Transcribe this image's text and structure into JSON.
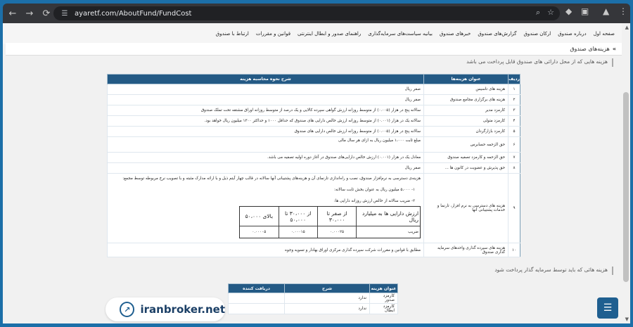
{
  "browser": {
    "url": "ayaretf.com/AboutFund/FundCost",
    "back_icon": "←",
    "forward_icon": "→",
    "reload_icon": "⟳",
    "site_info_icon": "☰",
    "zoom_icon": "⌕",
    "star_icon": "☆",
    "ext1_icon": "◆",
    "ext2_icon": "▣",
    "profile_icon": "▲",
    "menu_icon": "⋮"
  },
  "nav": {
    "items": [
      "صفحه اول",
      "درباره صندوق",
      "ارکان صندوق",
      "گزارش‌های صندوق",
      "خبرهای صندوق",
      "بیانیه سیاست‌های سرمایه‌گذاری",
      "راهنمای صدور و ابطال اینترنتی",
      "قوانین و مقررات",
      "ارتباط با صندوق"
    ]
  },
  "breadcrumb": {
    "arrow": "»",
    "label": "هزینه‌های صندوق"
  },
  "notes": {
    "fund_costs": "هزینه هایی که از محل دارائی های صندوق قابل پرداخت می باشد",
    "investor_costs": "هزینه هائی که باید توسط سرمایه گذار پرداخت شود"
  },
  "main_table": {
    "headers": {
      "row": "ردیف",
      "title": "عنوان هزینه‌ها",
      "desc": "شرح نحوه محاسبه هزینه"
    },
    "rows": [
      {
        "num": "۱",
        "title": "هزینه های تاسیس",
        "desc": "صفر ریال"
      },
      {
        "num": "۲",
        "title": "هزینه های برگزاری مجامع صندوق",
        "desc": "صفر ریال"
      },
      {
        "num": "۳",
        "title": "کارمزد مدیر",
        "desc": "سالانه پنج در هزار (۰.۰۰۵) از متوسط روزانه ارزش گواهی سپرده کالایی و یک درصد از متوسط روزانه اوراق مشتقه تحت تملک صندوق"
      },
      {
        "num": "۴",
        "title": "کارمزد متولی",
        "desc": "سالانه یک در هزار (۰.۰۰۱) از متوسط روزانه ارزش خالص دارایی های صندوق که حداقل ۱۰۰۰ و حداکثر ۱۳۰۰ میلیون ریال خواهد بود."
      },
      {
        "num": "۵",
        "title": "کارمزد بازارگردان",
        "desc": "سالانه پنج در هزار (۰.۰۰۵) از متوسط روزانه ارزش خالص دارایی های صندوق"
      },
      {
        "num": "۶",
        "title": "حق الزحمه حسابرس",
        "desc": "مبلغ ثابت ۱،۰۰۰ میلیون ریال به ازای هر سال مالی"
      },
      {
        "num": "۷",
        "title": "حق الزحمه و کارمزد تصفیه صندوق",
        "desc": "معادل یک در هزار (۰.۰۰۱) ارزش خالص دارایی‌های صندوق در آغاز دوره اولیه تصفیه می باشد."
      },
      {
        "num": "۸",
        "title": "حق پذیرش و عضویت در کانون ها ...",
        "desc": "صفر ریال"
      }
    ],
    "row9": {
      "num": "۹",
      "title": "هزینه های دسترسی به نرم افزار، تارنما و خدمات پشتیبانی آنها",
      "intro": "هزینه‌ی دسترسی به نرم‌افزار صندوق، نصب و راه‌اندازی تارنمای آن و هزینه‌های پشتیبانی آنها سالانه در قالب چهار آیتم ذیل و با ارائه مدارک مثبته و با تصویب نرخ مربوطه توسط مجمع:",
      "item1": "۱- ۵،۰۰۰ میلیون ریال به عنوان بخش ثابت سالانه:",
      "item2": "۲- ضریب سالانه از خالص ارزش روزانه دارایی ها:",
      "box": {
        "h1": "ارزش دارایی ها به میلیارد ریال",
        "h2": "از صفر تا ۳۰،۰۰۰",
        "h3": "از ۳۰،۰۰۰ تا ۵۰،۰۰۰",
        "h4": "بالای ۵۰،۰۰۰",
        "r1": "ضریب",
        "r2": "۰.۰۰۰۲۵",
        "r3": "۰.۰۰۰۱۵",
        "r4": "۰.۰۰۰۰۵"
      }
    },
    "row10": {
      "num": "۱۰",
      "title": "هزینه های سپرده گذاری واحدهای سرمایه گذاری صندوق",
      "desc": "مطابق با قوانین و مقررات شرکت سپرده گذاری مرکزی اوراق بهادار و تسویه وجوه"
    }
  },
  "small_table": {
    "headers": {
      "title": "عنوان هزینه",
      "desc": "شرح",
      "receiver": "دریافت کننده"
    },
    "rows": [
      {
        "title": "کارمزد صدور",
        "desc": "ندارد",
        "receiver": ""
      },
      {
        "title": "کارمزد ابطال",
        "desc": "ندارد",
        "receiver": ""
      }
    ]
  },
  "watermark": {
    "text": "iranbroker.net",
    "logo": "↗"
  },
  "chat": {
    "icon": "☰"
  }
}
